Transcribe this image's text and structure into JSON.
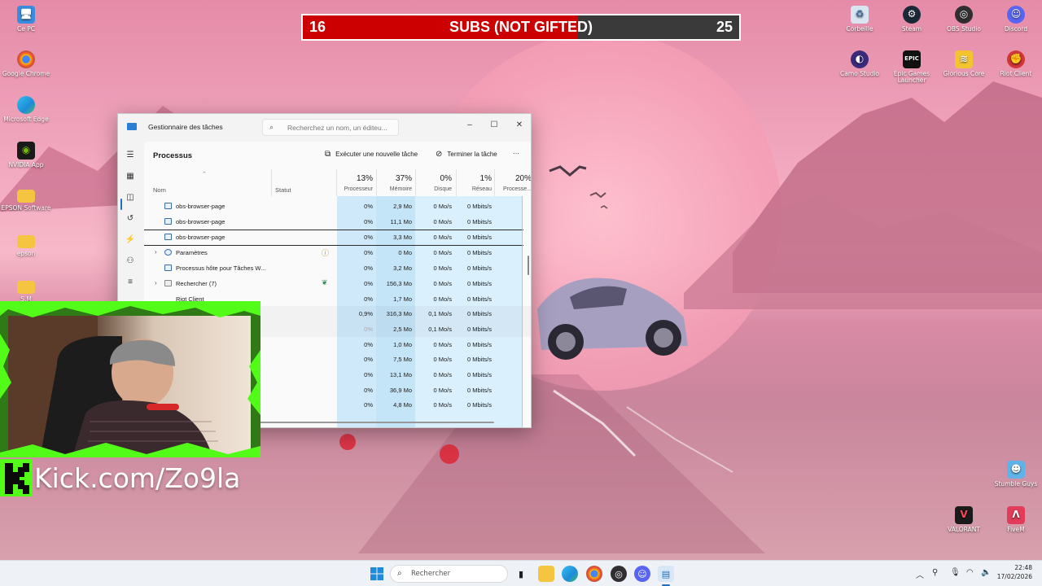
{
  "desktop": {
    "icons_left": [
      {
        "label": "Ce PC",
        "icon": "computer-icon",
        "color": "#3a8dde"
      },
      {
        "label": "Google Chrome",
        "icon": "chrome-icon",
        "color": "#e8453c"
      },
      {
        "label": "Microsoft Edge",
        "icon": "edge-icon",
        "color": "#1e8bd6"
      },
      {
        "label": "NVIDIA App",
        "icon": "nvidia-icon",
        "color": "#76b900"
      },
      {
        "label": "EPSON Software",
        "icon": "folder-icon",
        "color": "#f5c542"
      },
      {
        "label": "epson",
        "icon": "folder-icon",
        "color": "#f5c542"
      },
      {
        "label": "S.M",
        "icon": "folder-icon",
        "color": "#f5c542"
      }
    ],
    "icons_right_row1": [
      {
        "label": "Corbeille",
        "icon": "recycle-bin-icon",
        "color": "#d9e6f2"
      },
      {
        "label": "Steam",
        "icon": "steam-icon",
        "color": "#1b2838"
      },
      {
        "label": "OBS Studio",
        "icon": "obs-icon",
        "color": "#302e31"
      },
      {
        "label": "Discord",
        "icon": "discord-icon",
        "color": "#5865f2"
      }
    ],
    "icons_right_row2": [
      {
        "label": "Camo Studio",
        "icon": "camo-icon",
        "color": "#3a2a7a"
      },
      {
        "label": "Epic Games Launcher",
        "icon": "epic-icon",
        "color": "#111111"
      },
      {
        "label": "Glorious Core",
        "icon": "glorious-icon",
        "color": "#f4c430"
      },
      {
        "label": "Riot Client",
        "icon": "riot-icon",
        "color": "#d13639"
      }
    ],
    "icons_bottom_right": [
      {
        "label": "Stumble Guys",
        "icon": "stumble-icon",
        "color": "#5fb3e8"
      },
      {
        "label": "VALORANT",
        "icon": "valorant-icon",
        "color": "#ff4655"
      },
      {
        "label": "FiveM",
        "icon": "fivem-icon",
        "color": "#e23c5a"
      }
    ]
  },
  "subs_goal": {
    "current": "16",
    "label": "SUBS (NOT GIFTED)",
    "target": "25",
    "progress": 0.63,
    "fill_color": "#cc0000"
  },
  "task_manager": {
    "title": "Gestionnaire des tâches",
    "search_placeholder": "Recherchez un nom, un éditeu...",
    "heading": "Processus",
    "run_task_label": "Exécuter une nouvelle tâche",
    "end_task_label": "Terminer la tâche",
    "more_label": "···",
    "columns": {
      "name": "Nom",
      "status": "Statut",
      "cpu_pct": "13%",
      "cpu_label": "Processeur",
      "mem_pct": "37%",
      "mem_label": "Mémoire",
      "disk_pct": "0%",
      "disk_label": "Disque",
      "net_pct": "1%",
      "net_label": "Réseau",
      "gpu_pct": "20%",
      "gpu_label": "Processe..."
    },
    "rows": [
      {
        "name": "obs-browser-page",
        "cpu": "0%",
        "mem": "2,9 Mo",
        "disk": "0 Mo/s",
        "net": "0 Mbits/s"
      },
      {
        "name": "obs-browser-page",
        "cpu": "0%",
        "mem": "11,1 Mo",
        "disk": "0 Mo/s",
        "net": "0 Mbits/s"
      },
      {
        "name": "obs-browser-page",
        "cpu": "0%",
        "mem": "3,3 Mo",
        "disk": "0 Mo/s",
        "net": "0 Mbits/s"
      },
      {
        "name": "Paramètres",
        "cpu": "0%",
        "mem": "0 Mo",
        "disk": "0 Mo/s",
        "net": "0 Mbits/s"
      },
      {
        "name": "Processus hôte pour Tâches W...",
        "cpu": "0%",
        "mem": "3,2 Mo",
        "disk": "0 Mo/s",
        "net": "0 Mbits/s"
      },
      {
        "name": "Rechercher (7)",
        "cpu": "0%",
        "mem": "156,3 Mo",
        "disk": "0 Mo/s",
        "net": "0 Mbits/s"
      },
      {
        "name": "Riot Client",
        "cpu": "0%",
        "mem": "1,7 Mo",
        "disk": "0 Mo/s",
        "net": "0 Mbits/s"
      },
      {
        "name": "",
        "cpu": "0,9%",
        "mem": "316,3 Mo",
        "disk": "0,1 Mo/s",
        "net": "0 Mbits/s"
      },
      {
        "name": "",
        "cpu": "0%",
        "mem": "2,5 Mo",
        "disk": "0,1 Mo/s",
        "net": "0 Mbits/s"
      },
      {
        "name": "",
        "cpu": "0%",
        "mem": "1,0 Mo",
        "disk": "0 Mo/s",
        "net": "0 Mbits/s"
      },
      {
        "name": "",
        "cpu": "0%",
        "mem": "7,5 Mo",
        "disk": "0 Mo/s",
        "net": "0 Mbits/s"
      },
      {
        "name": "",
        "cpu": "0%",
        "mem": "13,1 Mo",
        "disk": "0 Mo/s",
        "net": "0 Mbits/s"
      },
      {
        "name": "",
        "cpu": "0%",
        "mem": "36,9 Mo",
        "disk": "0 Mo/s",
        "net": "0 Mbits/s"
      },
      {
        "name": "",
        "cpu": "0%",
        "mem": "4,8 Mo",
        "disk": "0 Mo/s",
        "net": "0 Mbits/s"
      }
    ]
  },
  "overlay": {
    "kick_text": "Kick.com/Zo9la",
    "kick_color": "#53fc18"
  },
  "taskbar": {
    "search_placeholder": "Rechercher",
    "time": "22:48",
    "date": "17/02/2026"
  }
}
